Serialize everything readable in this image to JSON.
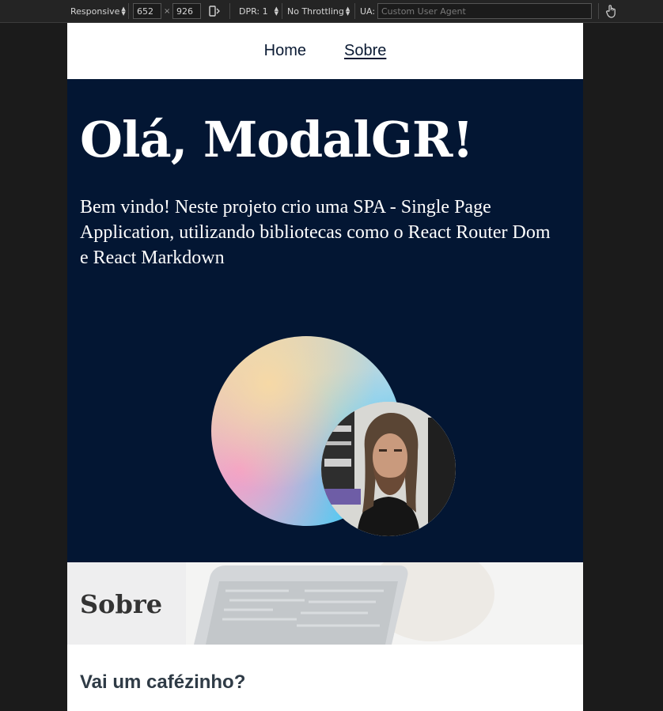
{
  "devtools": {
    "device": "Responsive",
    "width": "652",
    "height": "926",
    "times": "×",
    "dpr": "DPR: 1",
    "throttling": "No Throttling",
    "ua_label": "UA:",
    "ua_placeholder": "Custom User Agent"
  },
  "nav": {
    "items": [
      {
        "label": "Home",
        "active": false
      },
      {
        "label": "Sobre",
        "active": true
      }
    ]
  },
  "hero": {
    "title": "Olá, ModalGR!",
    "text": "Bem vindo! Neste projeto crio uma SPA - Single Page Application, utilizando bibliotecas como o React Router Dom e React Markdown",
    "colors": {
      "background": "#031633"
    }
  },
  "about": {
    "title": "Sobre",
    "subtitle": "Vai um cafézinho?"
  },
  "icons": {
    "rotate": "rotate-device-icon",
    "touch": "touch-cursor-icon"
  }
}
